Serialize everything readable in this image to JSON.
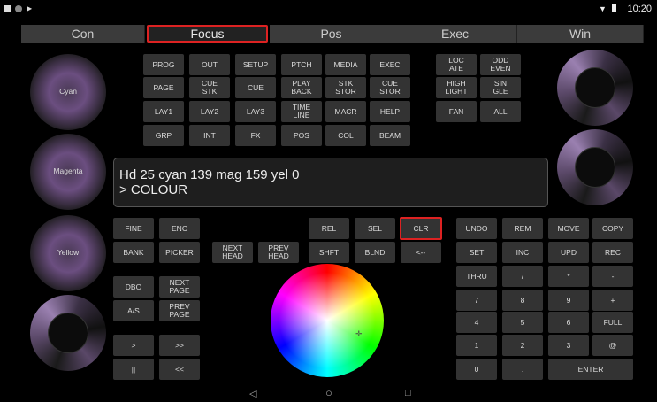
{
  "status": {
    "time": "10:20"
  },
  "tabs": [
    "Con",
    "Focus",
    "Pos",
    "Exec",
    "Win"
  ],
  "encoders": {
    "left": [
      "Cyan",
      "Magenta",
      "Yellow",
      ""
    ]
  },
  "grid1": [
    [
      "PROG",
      "OUT",
      "SETUP",
      "PTCH",
      "MEDIA",
      "EXEC"
    ],
    [
      "PAGE",
      "CUE\nSTK",
      "CUE",
      "PLAY\nBACK",
      "STK\nSTOR",
      "CUE\nSTOR"
    ],
    [
      "LAY1",
      "LAY2",
      "LAY3",
      "TIME\nLINE",
      "MACR",
      "HELP"
    ],
    [
      "GRP",
      "INT",
      "FX",
      "POS",
      "COL",
      "BEAM"
    ]
  ],
  "grid2": [
    [
      "LOC\nATE",
      "ODD\nEVEN"
    ],
    [
      "HIGH\nLIGHT",
      "SIN\nGLE"
    ],
    [
      "FAN",
      "ALL"
    ]
  ],
  "command": {
    "line1": "Hd 25 cyan 139 mag 159 yel 0",
    "line2": "> COLOUR"
  },
  "left_keys": {
    "fine": "FINE",
    "enc": "ENC",
    "bank": "BANK",
    "picker": "PICKER",
    "dbo": "DBO",
    "next_page": "NEXT\nPAGE",
    "as": "A/S",
    "prev_page": "PREV\nPAGE",
    "ff": ">",
    "ffff": ">>",
    "pause": "||",
    "rew": "<<"
  },
  "head_keys": {
    "next": "NEXT\nHEAD",
    "prev": "PREV\nHEAD"
  },
  "mid_keys": {
    "rel": "REL",
    "sel": "SEL",
    "clr": "CLR",
    "shft": "SHFT",
    "blnd": "BLND",
    "back": "<--"
  },
  "keypad": [
    [
      "UNDO",
      "REM",
      "MOVE",
      "COPY"
    ],
    [
      "SET",
      "INC",
      "UPD",
      "REC"
    ],
    [
      "THRU",
      "/",
      "*",
      "-"
    ],
    [
      "7",
      "8",
      "9",
      "+"
    ],
    [
      "4",
      "5",
      "6",
      "FULL"
    ],
    [
      "1",
      "2",
      "3",
      "@"
    ]
  ],
  "keypad_last": {
    "zero": "0",
    "dot": ".",
    "enter": "ENTER"
  },
  "navbar": {
    "back": "◁",
    "home": "○",
    "recent": "□"
  }
}
